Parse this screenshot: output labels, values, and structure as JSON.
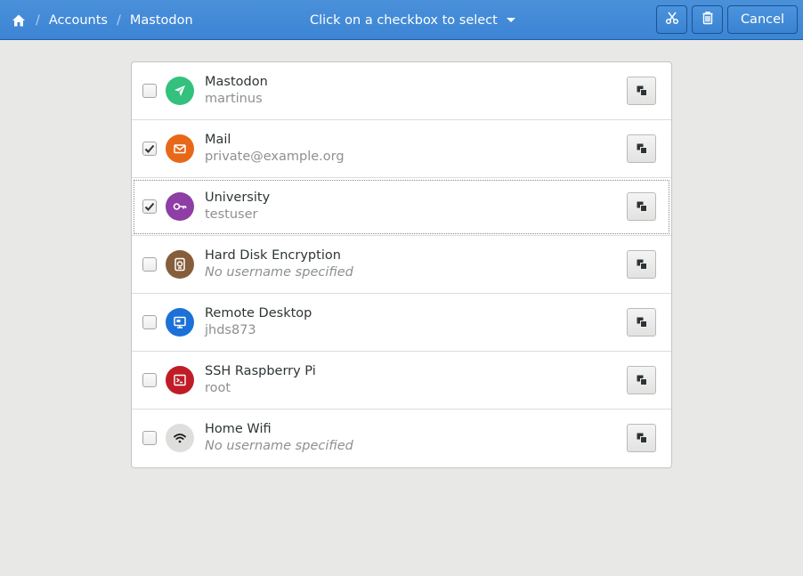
{
  "header": {
    "breadcrumbs": [
      "Accounts",
      "Mastodon"
    ],
    "selection_prompt": "Click on a checkbox to select",
    "cancel_label": "Cancel",
    "accent_color": "#4a90d9"
  },
  "icons": {
    "home": "home-icon",
    "dropdown": "chevron-down-icon",
    "cut": "scissors-icon",
    "delete": "trash-icon",
    "copy": "copy-icon"
  },
  "entries": [
    {
      "title": "Mastodon",
      "subtitle": "martinus",
      "checked": false,
      "color": "#33c17d",
      "icon": "send-icon"
    },
    {
      "title": "Mail",
      "subtitle": "private@example.org",
      "checked": true,
      "color": "#e8681a",
      "icon": "mail-icon"
    },
    {
      "title": "University",
      "subtitle": "testuser",
      "checked": true,
      "color": "#8e3ea4",
      "icon": "key-icon"
    },
    {
      "title": "Hard Disk Encryption",
      "subtitle": "No username specified",
      "checked": false,
      "color": "#865e3c",
      "icon": "disk-icon",
      "no_username": true
    },
    {
      "title": "Remote Desktop",
      "subtitle": "jhds873",
      "checked": false,
      "color": "#1c71d8",
      "icon": "monitor-icon"
    },
    {
      "title": "SSH Raspberry Pi",
      "subtitle": "root",
      "checked": false,
      "color": "#c01c28",
      "icon": "terminal-icon"
    },
    {
      "title": "Home Wifi",
      "subtitle": "No username specified",
      "checked": false,
      "color": "#dededd",
      "icon": "wifi-icon",
      "no_username": true
    }
  ]
}
